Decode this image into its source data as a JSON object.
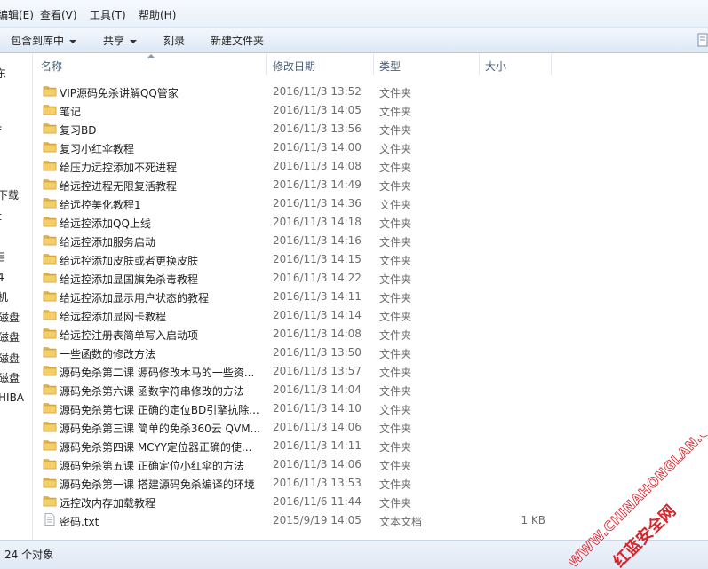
{
  "menu": [
    "编辑(E)",
    "查看(V)",
    "工具(T)",
    "帮助(H)"
  ],
  "toolbar": {
    "include_library": "包含到库中",
    "share": "共享",
    "burn": "刻录",
    "new_folder": "新建文件夹"
  },
  "nav_fragments": [
    "东",
    "i",
    "f",
    "i",
    "下载",
    "t",
    "l",
    "目",
    "4",
    "机",
    "磁盘",
    "磁盘",
    "磁盘",
    "磁盘",
    "HIBA"
  ],
  "columns": {
    "name": "名称",
    "date": "修改日期",
    "type": "类型",
    "size": "大小"
  },
  "files": [
    {
      "name": "VIP源码免杀讲解QQ管家",
      "date": "2016/11/3 13:52",
      "type": "文件夹",
      "size": ""
    },
    {
      "name": "笔记",
      "date": "2016/11/3 14:05",
      "type": "文件夹",
      "size": ""
    },
    {
      "name": "复习BD",
      "date": "2016/11/3 13:56",
      "type": "文件夹",
      "size": ""
    },
    {
      "name": "复习小红伞教程",
      "date": "2016/11/3 14:00",
      "type": "文件夹",
      "size": ""
    },
    {
      "name": "给压力远控添加不死进程",
      "date": "2016/11/3 14:08",
      "type": "文件夹",
      "size": ""
    },
    {
      "name": "给远控进程无限复活教程",
      "date": "2016/11/3 14:49",
      "type": "文件夹",
      "size": ""
    },
    {
      "name": "给远控美化教程1",
      "date": "2016/11/3 14:36",
      "type": "文件夹",
      "size": ""
    },
    {
      "name": "给远控添加QQ上线",
      "date": "2016/11/3 14:18",
      "type": "文件夹",
      "size": ""
    },
    {
      "name": "给远控添加服务启动",
      "date": "2016/11/3 14:16",
      "type": "文件夹",
      "size": ""
    },
    {
      "name": "给远控添加皮肤或者更换皮肤",
      "date": "2016/11/3 14:15",
      "type": "文件夹",
      "size": ""
    },
    {
      "name": "给远控添加显国旗免杀毒教程",
      "date": "2016/11/3 14:22",
      "type": "文件夹",
      "size": ""
    },
    {
      "name": "给远控添加显示用户状态的教程",
      "date": "2016/11/3 14:11",
      "type": "文件夹",
      "size": ""
    },
    {
      "name": "给远控添加显网卡教程",
      "date": "2016/11/3 14:14",
      "type": "文件夹",
      "size": ""
    },
    {
      "name": "给远控注册表简单写入启动项",
      "date": "2016/11/3 14:08",
      "type": "文件夹",
      "size": ""
    },
    {
      "name": "一些函数的修改方法",
      "date": "2016/11/3 13:50",
      "type": "文件夹",
      "size": ""
    },
    {
      "name": "源码免杀第二课 源码修改木马的一些资...",
      "date": "2016/11/3 13:57",
      "type": "文件夹",
      "size": ""
    },
    {
      "name": "源码免杀第六课 函数字符串修改的方法",
      "date": "2016/11/3 14:04",
      "type": "文件夹",
      "size": ""
    },
    {
      "name": "源码免杀第七课 正确的定位BD引擎抗除...",
      "date": "2016/11/3 14:10",
      "type": "文件夹",
      "size": ""
    },
    {
      "name": "源码免杀第三课 简单的免杀360云 QVM...",
      "date": "2016/11/3 14:06",
      "type": "文件夹",
      "size": ""
    },
    {
      "name": "源码免杀第四课 MCYY定位器正确的使...",
      "date": "2016/11/3 14:11",
      "type": "文件夹",
      "size": ""
    },
    {
      "name": "源码免杀第五课 正确定位小红伞的方法",
      "date": "2016/11/3 14:06",
      "type": "文件夹",
      "size": ""
    },
    {
      "name": "源码免杀第一课 搭建源码免杀编译的环境",
      "date": "2016/11/3 13:53",
      "type": "文件夹",
      "size": ""
    },
    {
      "name": "远控改内存加载教程",
      "date": "2016/11/6 11:44",
      "type": "文件夹",
      "size": ""
    },
    {
      "name": "密码.txt",
      "date": "2015/9/19 14:05",
      "type": "文本文档",
      "size": "1 KB",
      "icon": "text-file-icon"
    }
  ],
  "status": {
    "count": "24 个对象"
  },
  "watermark": {
    "url": "WWW.CHINAHONGLAN.COM",
    "name": "红蓝安全网"
  },
  "colors": {
    "folder": "#e9c15a",
    "header_text": "#4c607a",
    "muted_text": "#6d6d6d",
    "watermark": "#d9232a"
  }
}
